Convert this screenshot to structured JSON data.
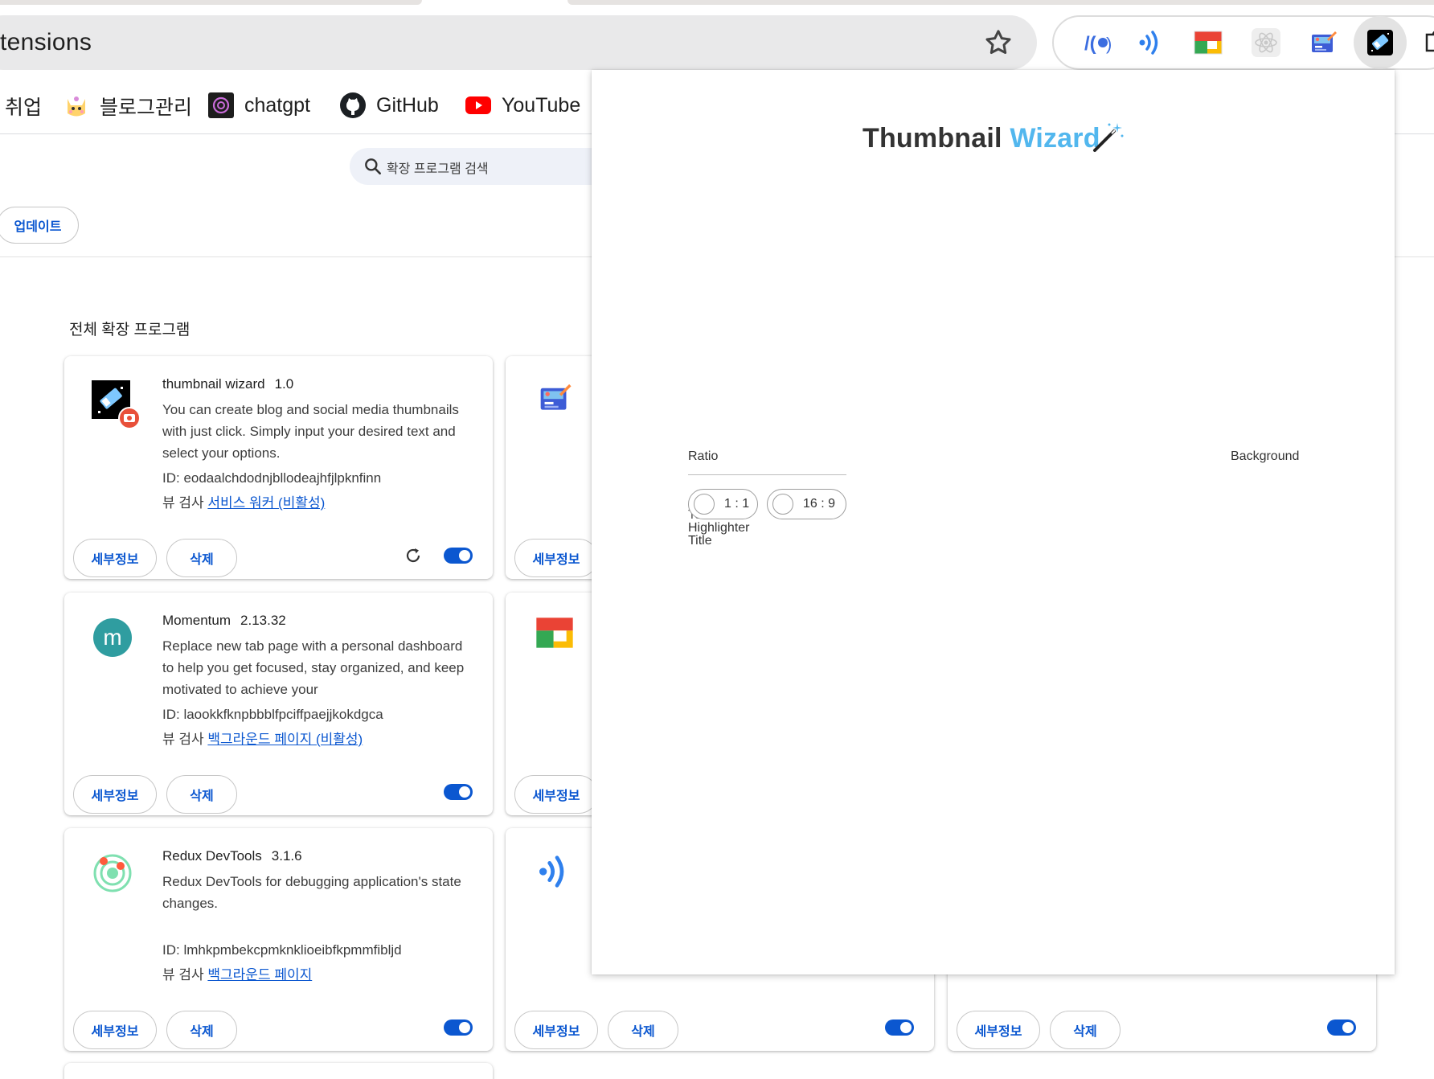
{
  "browser": {
    "omnibox_text": "tensions",
    "bookmarks": [
      {
        "label": "취업"
      },
      {
        "label": "블로그관리"
      },
      {
        "label": "chatgpt"
      },
      {
        "label": "GitHub"
      },
      {
        "label": "YouTube"
      }
    ],
    "extension_icons": [
      "postman-icon",
      "wifi-signal-icon",
      "multicolor-icon",
      "atom-icon",
      "picture-edit-icon",
      "thumbnail-wizard-icon",
      "puzzle-icon"
    ]
  },
  "page": {
    "search_placeholder": "확장 프로그램 검색",
    "update_button": "업데이트",
    "section_title": "전체 확장 프로그램",
    "buttons": {
      "details": "세부정보",
      "remove": "삭제"
    },
    "cards": [
      {
        "name": "thumbnail wizard",
        "version": "1.0",
        "description": "You can create blog and social media thumbnails with just click. Simply input your desired text and select your options.",
        "id_text": "ID: eodaalchdodnjbllodeajhfjlpknfinn",
        "inspect_prefix": "뷰 검사",
        "inspect_link": "서비스 워커 (비활성)",
        "enabled": true
      },
      {
        "name": "Momentum",
        "version": "2.13.32",
        "description": "Replace new tab page with a personal dashboard to help you get focused, stay organized, and keep motivated to achieve your",
        "id_text": "ID: laookkfknpbbblfpciffpaejjkokdgca",
        "inspect_prefix": "뷰 검사",
        "inspect_link": "백그라운드 페이지 (비활성)",
        "enabled": true
      },
      {
        "name": "Redux DevTools",
        "version": "3.1.6",
        "description": "Redux DevTools for debugging application's state changes.",
        "id_text": "ID: lmhkpmbekcpmknklioeibfkpmmfibljd",
        "inspect_prefix": "뷰 검사",
        "inspect_link": "백그라운드 페이지",
        "enabled": true
      }
    ]
  },
  "popup": {
    "title_part1": "Thumbnail",
    "title_part2": "Wizard",
    "ratio_label": "Ratio",
    "background_label": "Background",
    "ratio_options": [
      "1 : 1",
      "16 : 9"
    ],
    "text_color_label": "Text Color",
    "highlighter_label": "Highlighter",
    "title_label": "Title",
    "accent_color": "#52b7ee"
  },
  "colors": {
    "link_blue": "#0b57d0",
    "toggle_on": "#0b57d0"
  }
}
